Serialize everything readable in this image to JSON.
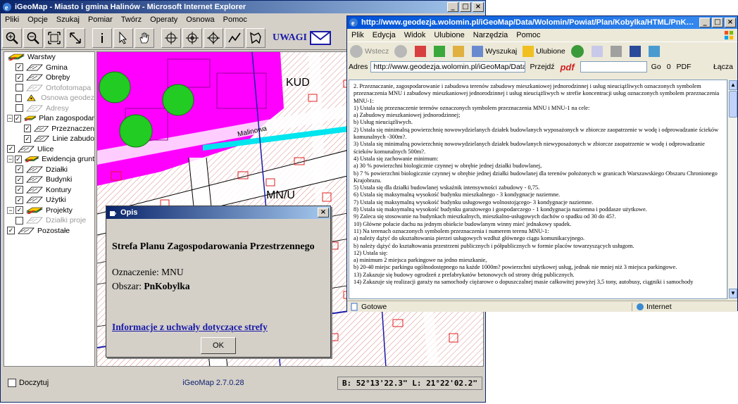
{
  "igeo": {
    "title": "iGeoMap - Miasto i gmina Halinów - Microsoft Internet Explorer",
    "menu": [
      "Pliki",
      "Opcje",
      "Szukaj",
      "Pomiar",
      "Twórz",
      "Operaty",
      "Osnowa",
      "Pomoc"
    ],
    "uwagi": "UWAGI",
    "layers": [
      {
        "label": "Warstwy",
        "level": 0,
        "toggle": "",
        "checked": null,
        "grey": false,
        "icon": "layers-icon"
      },
      {
        "label": "Gmina",
        "level": 1,
        "toggle": "",
        "checked": true,
        "grey": false,
        "icon": "polygon-icon"
      },
      {
        "label": "Obręby",
        "level": 1,
        "toggle": "",
        "checked": true,
        "grey": false,
        "icon": "polygon-icon"
      },
      {
        "label": "Ortofotomapa",
        "level": 1,
        "toggle": "",
        "checked": false,
        "grey": true,
        "icon": "polygon-icon"
      },
      {
        "label": "Osnowa geodez",
        "level": 1,
        "toggle": "",
        "checked": false,
        "grey": true,
        "icon": "survey-point-icon"
      },
      {
        "label": "Adresy",
        "level": 1,
        "toggle": "",
        "checked": false,
        "grey": true,
        "icon": "polygon-icon"
      },
      {
        "label": "Plan zagospodar",
        "level": 0,
        "toggle": "−",
        "checked": true,
        "grey": false,
        "icon": "layers-icon"
      },
      {
        "label": "Przeznaczen",
        "level": 2,
        "toggle": "",
        "checked": true,
        "grey": false,
        "icon": "polygon-icon"
      },
      {
        "label": "Linie zabudo",
        "level": 2,
        "toggle": "",
        "checked": true,
        "grey": false,
        "icon": "polygon-icon"
      },
      {
        "label": "Ulice",
        "level": 0,
        "toggle": "",
        "checked": true,
        "grey": false,
        "icon": "polygon-icon"
      },
      {
        "label": "Ewidencja grunt",
        "level": 0,
        "toggle": "−",
        "checked": true,
        "grey": false,
        "icon": "layers-icon"
      },
      {
        "label": "Działki",
        "level": 1,
        "toggle": "",
        "checked": true,
        "grey": false,
        "icon": "polygon-icon"
      },
      {
        "label": "Budynki",
        "level": 1,
        "toggle": "",
        "checked": true,
        "grey": false,
        "icon": "polygon-icon"
      },
      {
        "label": "Kontury",
        "level": 1,
        "toggle": "",
        "checked": true,
        "grey": false,
        "icon": "polygon-icon"
      },
      {
        "label": "Użytki",
        "level": 1,
        "toggle": "",
        "checked": true,
        "grey": false,
        "icon": "polygon-icon"
      },
      {
        "label": "Projekty",
        "level": 0,
        "toggle": "−",
        "checked": true,
        "grey": false,
        "icon": "layers-icon"
      },
      {
        "label": "Działki proje",
        "level": 1,
        "toggle": "",
        "checked": false,
        "grey": true,
        "icon": "polygon-icon"
      },
      {
        "label": "Pozostałe",
        "level": 0,
        "toggle": "",
        "checked": true,
        "grey": false,
        "icon": "polygon-icon"
      }
    ],
    "map_labels": {
      "kud": "KUD",
      "malinowa": "Malinowa",
      "mnu": "MN/U"
    },
    "status": {
      "checkbox_label": "Doczytuj",
      "version": "iGeoMap 2.7.0.28",
      "coords": "B: 52°13'22.3\" L: 21°22'02.2\""
    }
  },
  "opis": {
    "title": "Opis",
    "heading": "Strefa Planu Zagospodarowania Przestrzennego",
    "oznaczenie_label": "Oznaczenie:",
    "oznaczenie_value": "MNU",
    "obszar_label": "Obszar:",
    "obszar_value": "PnKobylka",
    "link": "Informacje z uchwały dotyczące strefy",
    "ok": "OK"
  },
  "ie": {
    "title": "http://www.geodezja.wolomin.pl/iGeoMap/Data/Wolomin/Powiat/Plan/Kobylka/HTML/PnKobylka,MNU.html - Microsoft Internet Explorer",
    "menu": [
      "Plik",
      "Edycja",
      "Widok",
      "Ulubione",
      "Narzędzia",
      "Pomoc"
    ],
    "toolbar": {
      "back": "Wstecz",
      "search": "Wyszukaj",
      "favorites": "Ulubione"
    },
    "address_label": "Adres",
    "address_value": "http://www.geodezja.wolomin.pl/iGeoMap/Data/Wo",
    "go": "Przejdź",
    "pdf_badge": "pdf",
    "go2": "Go",
    "pdf_count": "0",
    "pdf2": "PDF",
    "links": "Łącza",
    "content": [
      "2. Przeznaczanie, zagospodarowanie i zabudowa terenów zabudowy mieszkaniowej jednorodzinnej i usług nieuciążliwych oznaczonych symbolem przeznaczenia MNU i zabudowy mieszkaniowej jednorodzinnej i usług nieuciążliwych w strefie koncentracji usług oznaczonych symbolem przeznaczenia MNU-1:",
      "1) Ustala się przeznaczenie terenów oznaczonych symbolem przeznaczenia MNU i MNU-1 na cele:",
      "a) Zabudowy mieszkaniowej jednorodzinnej;",
      "b) Usług nieuciążliwych.",
      "2) Ustala się minimalną powierzchnię nowowydzielanych działek budowlanych wyposażonych w zbiorcze zaopatrzenie w wodę i odprowadzanie ścieków komunalnych -300m?.",
      "3) Ustala się minimalną powierzchnię nowowydzielanych działek budowlanych niewyposażonych w zbiorcze zaopatrzenie w wodę i odprowadzanie ścieków komunalnych 500m?.",
      "4) Ustala się zachowanie minimum:",
      "a) 30 % powierzchni biologicznie czynnej w obrębie jednej działki budowlanej,",
      "b) 7 % powierzchni biologicznie czynnej w obrębie jednej działki budowlanej dla terenów położonych w granicach Warszawskiego Obszaru Chronionego Krajobrazu.",
      "5) Ustala się dla działki budowlanej wskaźnik intensywności zabudowy - 0,75.",
      "6) Ustala się maksymalną wysokość budynku mieszkalnego - 3 kondygnacje naziemne.",
      "7) Ustala się maksymalną wysokość budynku usługowego wolnostojącego- 3 kondygnacje naziemne.",
      "8) Ustala się maksymalną wysokość budynku garażowego i gospodarczego - 1 kondygnacja naziemna i poddasze użytkowe.",
      "9) Zaleca się stosowanie na budynkach mieszkalnych, mieszkalno-usługowych dachów o spadku od 30 do 45?.",
      "10) Główne połacie dachu na jednym obiekcie budowlanym winny mieć jednakowy spadek.",
      "11) Na terenach oznaczonych symbolem przeznaczenia i numerem terenu MNU-1:",
      "a) należy dążyć do ukształtowania pierzei usługowych wzdłuż głównego ciągu komunikacyjnego.",
      "b) należy dążyć do kształtowania przestrzeni publicznych i półpublicznych w formie placów towarzyszących usługom.",
      "12) Ustala się:",
      "a) minimum 2 miejsca parkingowe na jedno mieszkanie,",
      "b) 20-40 miejsc parkingu ogólnodostępnego na każde 1000m? powierzchni użytkowej usług, jednak nie mniej niż 3 miejsca parkingowe.",
      "13) Zakazuje się budowy ogrodzeń z prefabrykatów betonowych od strony dróg publicznych.",
      "14) Zakazuje się realizacji garaży na samochody ciężarowe o dopuszczalnej masie całkowitej powyżej 3,5 tony, autobusy, ciągniki i samochody"
    ],
    "status_left": "Gotowe",
    "status_zone": "Internet"
  },
  "colors": {
    "xp_title_blue": "#0052d6",
    "classic_title": "#0a246a",
    "link_blue": "#1a1aa8",
    "zone_magenta": "#ff00ff",
    "tree_green": "#22cc22",
    "road_cyan": "#00e5ee"
  }
}
